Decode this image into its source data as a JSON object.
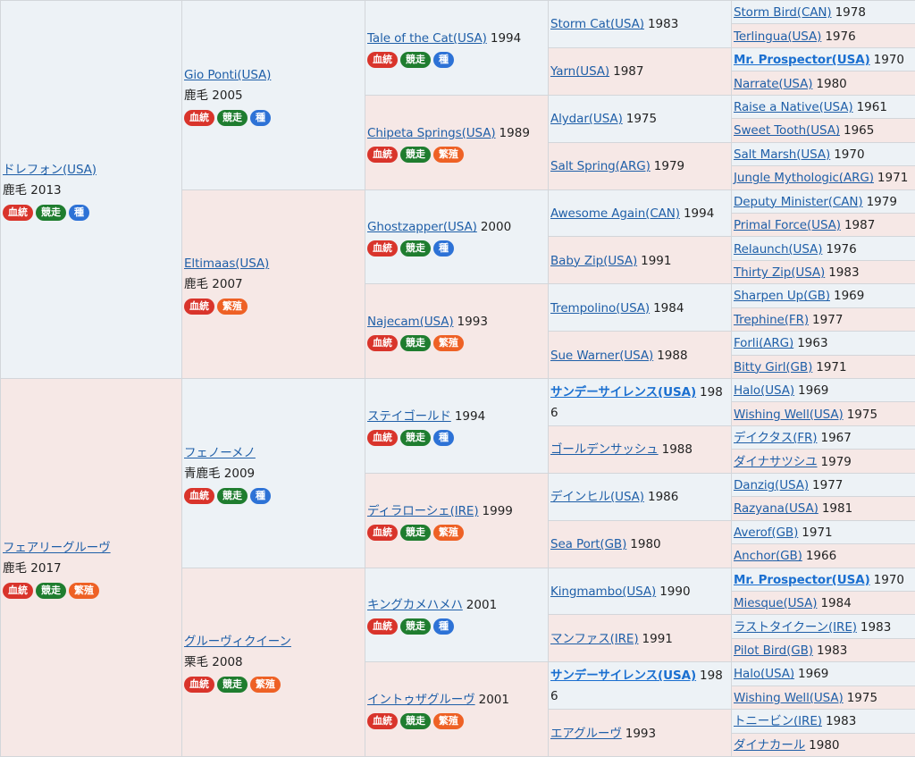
{
  "colors": {
    "male_bg": "#edf2f6",
    "female_bg": "#f6e8e6",
    "link": "#1f5fa8"
  },
  "badge_labels": {
    "ketto": "血統",
    "kyoso": "競走",
    "shu": "種",
    "hanshoku": "繁殖"
  },
  "gen1": [
    {
      "name": "ドレフォン(USA)",
      "coat": "鹿毛 2013"
    },
    {
      "name": "フェアリーグルーヴ",
      "coat": "鹿毛 2017"
    }
  ],
  "gen2": [
    {
      "name": "Gio Ponti(USA)",
      "coat": "鹿毛 2005"
    },
    {
      "name": "Eltimaas(USA)",
      "coat": "鹿毛 2007"
    },
    {
      "name": "フェノーメノ",
      "coat": "青鹿毛 2009"
    },
    {
      "name": "グルーヴィクイーン",
      "coat": "栗毛 2008"
    }
  ],
  "gen3": [
    {
      "name": "Tale of the Cat(USA)",
      "year": "1994"
    },
    {
      "name": "Chipeta Springs(USA)",
      "year": "1989"
    },
    {
      "name": "Ghostzapper(USA)",
      "year": "2000"
    },
    {
      "name": "Najecam(USA)",
      "year": "1993"
    },
    {
      "name": "ステイゴールド",
      "year": "1994"
    },
    {
      "name": "ディラローシェ(IRE)",
      "year": "1999"
    },
    {
      "name": "キングカメハメハ",
      "year": "2001"
    },
    {
      "name": "イントゥザグルーヴ",
      "year": "2001"
    }
  ],
  "gen4": [
    {
      "name": "Storm Cat(USA)",
      "year": "1983"
    },
    {
      "name": "Yarn(USA)",
      "year": "1987"
    },
    {
      "name": "Alydar(USA)",
      "year": "1975"
    },
    {
      "name": "Salt Spring(ARG)",
      "year": "1979"
    },
    {
      "name": "Awesome Again(CAN)",
      "year": "1994"
    },
    {
      "name": "Baby Zip(USA)",
      "year": "1991"
    },
    {
      "name": "Trempolino(USA)",
      "year": "1984"
    },
    {
      "name": "Sue Warner(USA)",
      "year": "1988"
    },
    {
      "name": "サンデーサイレンス(USA)",
      "year": "1986"
    },
    {
      "name": "ゴールデンサッシュ",
      "year": "1988"
    },
    {
      "name": "デインヒル(USA)",
      "year": "1986"
    },
    {
      "name": "Sea Port(GB)",
      "year": "1980"
    },
    {
      "name": "Kingmambo(USA)",
      "year": "1990"
    },
    {
      "name": "マンファス(IRE)",
      "year": "1991"
    },
    {
      "name": "サンデーサイレンス(USA)",
      "year": "1986"
    },
    {
      "name": "エアグルーヴ",
      "year": "1993"
    }
  ],
  "gen5": [
    {
      "name": "Storm Bird(CAN)",
      "year": "1978"
    },
    {
      "name": "Terlingua(USA)",
      "year": "1976"
    },
    {
      "name": "Mr. Prospector(USA)",
      "year": "1970"
    },
    {
      "name": "Narrate(USA)",
      "year": "1980"
    },
    {
      "name": "Raise a Native(USA)",
      "year": "1961"
    },
    {
      "name": "Sweet Tooth(USA)",
      "year": "1965"
    },
    {
      "name": "Salt Marsh(USA)",
      "year": "1970"
    },
    {
      "name": "Jungle Mythologic(ARG)",
      "year": "1971"
    },
    {
      "name": "Deputy Minister(CAN)",
      "year": "1979"
    },
    {
      "name": "Primal Force(USA)",
      "year": "1987"
    },
    {
      "name": "Relaunch(USA)",
      "year": "1976"
    },
    {
      "name": "Thirty Zip(USA)",
      "year": "1983"
    },
    {
      "name": "Sharpen Up(GB)",
      "year": "1969"
    },
    {
      "name": "Trephine(FR)",
      "year": "1977"
    },
    {
      "name": "Forli(ARG)",
      "year": "1963"
    },
    {
      "name": "Bitty Girl(GB)",
      "year": "1971"
    },
    {
      "name": "Halo(USA)",
      "year": "1969"
    },
    {
      "name": "Wishing Well(USA)",
      "year": "1975"
    },
    {
      "name": "デイクタス(FR)",
      "year": "1967"
    },
    {
      "name": "ダイナサツシユ",
      "year": "1979"
    },
    {
      "name": "Danzig(USA)",
      "year": "1977"
    },
    {
      "name": "Razyana(USA)",
      "year": "1981"
    },
    {
      "name": "Averof(GB)",
      "year": "1971"
    },
    {
      "name": "Anchor(GB)",
      "year": "1966"
    },
    {
      "name": "Mr. Prospector(USA)",
      "year": "1970"
    },
    {
      "name": "Miesque(USA)",
      "year": "1984"
    },
    {
      "name": "ラストタイクーン(IRE)",
      "year": "1983"
    },
    {
      "name": "Pilot Bird(GB)",
      "year": "1983"
    },
    {
      "name": "Halo(USA)",
      "year": "1969"
    },
    {
      "name": "Wishing Well(USA)",
      "year": "1975"
    },
    {
      "name": "トニービン(IRE)",
      "year": "1983"
    },
    {
      "name": "ダイナカール",
      "year": "1980"
    }
  ]
}
